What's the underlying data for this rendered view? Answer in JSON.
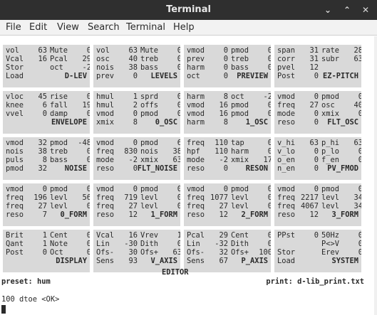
{
  "window": {
    "title": "Terminal",
    "min_glyph": "⌄",
    "max_glyph": "⌃",
    "close_glyph": "✕"
  },
  "menu": [
    "File",
    "Edit",
    "View",
    "Search",
    "Terminal",
    "Help"
  ],
  "panels": [
    {
      "rows": [
        [
          "vol",
          "63",
          "Mute",
          "0"
        ],
        [
          "Vcal",
          "16",
          "Pcal",
          "29"
        ],
        [
          "Stor",
          "",
          "oct",
          "-2"
        ],
        [
          "Load",
          "",
          "",
          ""
        ]
      ],
      "title": "D-LEV"
    },
    {
      "rows": [
        [
          "vol",
          "63",
          "Mute",
          "0"
        ],
        [
          "osc",
          "40",
          "treb",
          "0"
        ],
        [
          "nois",
          "38",
          "bass",
          "0"
        ],
        [
          "prev",
          "0",
          "",
          ""
        ]
      ],
      "title": "LEVELS"
    },
    {
      "rows": [
        [
          "vmod",
          "0",
          "pmod",
          "0"
        ],
        [
          "prev",
          "0",
          "treb",
          "0"
        ],
        [
          "harm",
          "0",
          "bass",
          "0"
        ],
        [
          "oct",
          "0",
          "",
          ""
        ]
      ],
      "title": "PREVIEW"
    },
    {
      "rows": [
        [
          "span",
          "31",
          "rate",
          "28"
        ],
        [
          "corr",
          "31",
          "subr",
          "63"
        ],
        [
          "pvel",
          "12",
          "",
          ""
        ],
        [
          "Post",
          "0",
          "",
          ""
        ]
      ],
      "title": "EZ-PITCH"
    },
    {
      "rows": [
        [
          "vloc",
          "45",
          "rise",
          "0"
        ],
        [
          "knee",
          "6",
          "fall",
          "19"
        ],
        [
          "vvel",
          "0",
          "damp",
          "0"
        ],
        [
          "",
          "",
          "",
          ""
        ]
      ],
      "title": "ENVELOPE"
    },
    {
      "rows": [
        [
          "hmul",
          "1",
          "sprd",
          "0"
        ],
        [
          "hmul",
          "2",
          "offs",
          "0"
        ],
        [
          "vmod",
          "0",
          "pmod",
          "0"
        ],
        [
          "xmix",
          "8",
          "",
          ""
        ]
      ],
      "title": "0_OSC"
    },
    {
      "rows": [
        [
          "harm",
          "8",
          "oct",
          "-2"
        ],
        [
          "vmod",
          "16",
          "pmod",
          "0"
        ],
        [
          "vmod",
          "16",
          "pmod",
          "0"
        ],
        [
          "harm",
          "8",
          "",
          ""
        ]
      ],
      "title": "1_OSC"
    },
    {
      "rows": [
        [
          "vmod",
          "0",
          "pmod",
          "0"
        ],
        [
          "freq",
          "27",
          "osc",
          "40"
        ],
        [
          "mode",
          "0",
          "xmix",
          "0"
        ],
        [
          "reso",
          "0",
          "",
          ""
        ]
      ],
      "title": "FLT_OSC"
    },
    {
      "rows": [
        [
          "vmod",
          "32",
          "pmod",
          "-48"
        ],
        [
          "nois",
          "38",
          "treb",
          "0"
        ],
        [
          "puls",
          "8",
          "bass",
          "0"
        ],
        [
          "pmod",
          "32",
          "",
          ""
        ]
      ],
      "title": "NOISE"
    },
    {
      "rows": [
        [
          "vmod",
          "0",
          "pmod",
          "6"
        ],
        [
          "freq",
          "830",
          "nois",
          "38"
        ],
        [
          "mode",
          "-2",
          "xmix",
          "63"
        ],
        [
          "reso",
          "0",
          "",
          ""
        ]
      ],
      "title": "FLT_NOISE"
    },
    {
      "rows": [
        [
          "freq",
          "110",
          "tap",
          "0"
        ],
        [
          "hpf",
          "110",
          "harm",
          "0"
        ],
        [
          "mode",
          "-2",
          "xmix",
          "17"
        ],
        [
          "reso",
          "0",
          "",
          ""
        ]
      ],
      "title": "RESON"
    },
    {
      "rows": [
        [
          "v_hi",
          "63",
          "p_hi",
          "63"
        ],
        [
          "v_lo",
          "0",
          "p_lo",
          "0"
        ],
        [
          "o_en",
          "0",
          "f_en",
          "0"
        ],
        [
          "n_en",
          "0",
          "",
          ""
        ]
      ],
      "title": "PV_FMOD"
    },
    {
      "rows": [
        [
          "vmod",
          "0",
          "pmod",
          "0"
        ],
        [
          "freq",
          "196",
          "levl",
          "56"
        ],
        [
          "freq",
          "27",
          "levl",
          "0"
        ],
        [
          "reso",
          "7",
          "",
          ""
        ]
      ],
      "title": "0_FORM"
    },
    {
      "rows": [
        [
          "vmod",
          "0",
          "pmod",
          "0"
        ],
        [
          "freq",
          "719",
          "levl",
          "0"
        ],
        [
          "freq",
          "27",
          "levl",
          "0"
        ],
        [
          "reso",
          "12",
          "",
          ""
        ]
      ],
      "title": "1_FORM"
    },
    {
      "rows": [
        [
          "vmod",
          "0",
          "pmod",
          "0"
        ],
        [
          "freq",
          "1077",
          "levl",
          "0"
        ],
        [
          "freq",
          "27",
          "levl",
          "0"
        ],
        [
          "reso",
          "12",
          "",
          ""
        ]
      ],
      "title": "2_FORM"
    },
    {
      "rows": [
        [
          "vmod",
          "0",
          "pmod",
          "0"
        ],
        [
          "freq",
          "2217",
          "levl",
          "34"
        ],
        [
          "freq",
          "4067",
          "levl",
          "34"
        ],
        [
          "reso",
          "12",
          "",
          ""
        ]
      ],
      "title": "3_FORM"
    },
    {
      "rows": [
        [
          "Brit",
          "1",
          "Cent",
          "0"
        ],
        [
          "Qant",
          "1",
          "Note",
          "0"
        ],
        [
          "Post",
          "0",
          "Oct",
          "0"
        ],
        [
          "",
          "",
          "",
          ""
        ]
      ],
      "title": "DISPLAY"
    },
    {
      "rows": [
        [
          "Vcal",
          "16",
          "Vrev",
          "1"
        ],
        [
          "Lin",
          "-30",
          "Dith",
          "0"
        ],
        [
          "Ofs-",
          "30",
          "Ofs+",
          "63"
        ],
        [
          "Sens",
          "93",
          "",
          ""
        ]
      ],
      "title": "V_AXIS"
    },
    {
      "rows": [
        [
          "Pcal",
          "29",
          "Cent",
          "0"
        ],
        [
          "Lin",
          "-32",
          "Dith",
          "0"
        ],
        [
          "Ofs-",
          "32",
          "Ofs+",
          "100"
        ],
        [
          "Sens",
          "67",
          "",
          ""
        ]
      ],
      "title": "P_AXIS"
    },
    {
      "rows": [
        [
          "PPst",
          "0",
          "50Hz",
          "0"
        ],
        [
          "",
          "",
          "P<>V",
          "0"
        ],
        [
          "Stor",
          "",
          "Erev",
          "0"
        ],
        [
          "Load",
          "",
          "",
          ""
        ]
      ],
      "title": "SYSTEM"
    }
  ],
  "editor_label": "EDITOR",
  "status": {
    "preset": "preset: hum",
    "print": "print: d-lib_print.txt"
  },
  "command_line": "100 dtoe <OK>"
}
